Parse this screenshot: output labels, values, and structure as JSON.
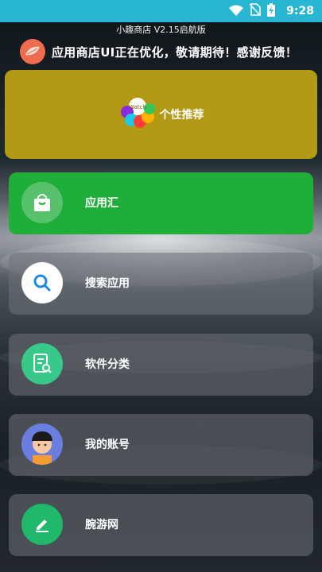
{
  "status_bar": {
    "time": "9:28",
    "icons": [
      "wifi-icon",
      "no-sim-icon",
      "battery-charging-icon"
    ]
  },
  "app": {
    "title": "小趣商店 V2.15启航版",
    "notice": "应用商店UI正在优化，敬请期待！感谢反馈！"
  },
  "recommend": {
    "label": "个性推荐",
    "logo_text": "Watch"
  },
  "menu": [
    {
      "label": "应用汇",
      "icon": "shopping-bag-icon"
    },
    {
      "label": "搜索应用",
      "icon": "search-icon"
    },
    {
      "label": "软件分类",
      "icon": "document-search-icon"
    },
    {
      "label": "我的账号",
      "icon": "avatar-icon"
    },
    {
      "label": "腕游网",
      "icon": "edit-icon"
    }
  ],
  "colors": {
    "status_bar": "#29b6d2",
    "recommend_card": "#b29a16",
    "app_card": "#1fae3a",
    "card_gray": "#6e7378"
  }
}
